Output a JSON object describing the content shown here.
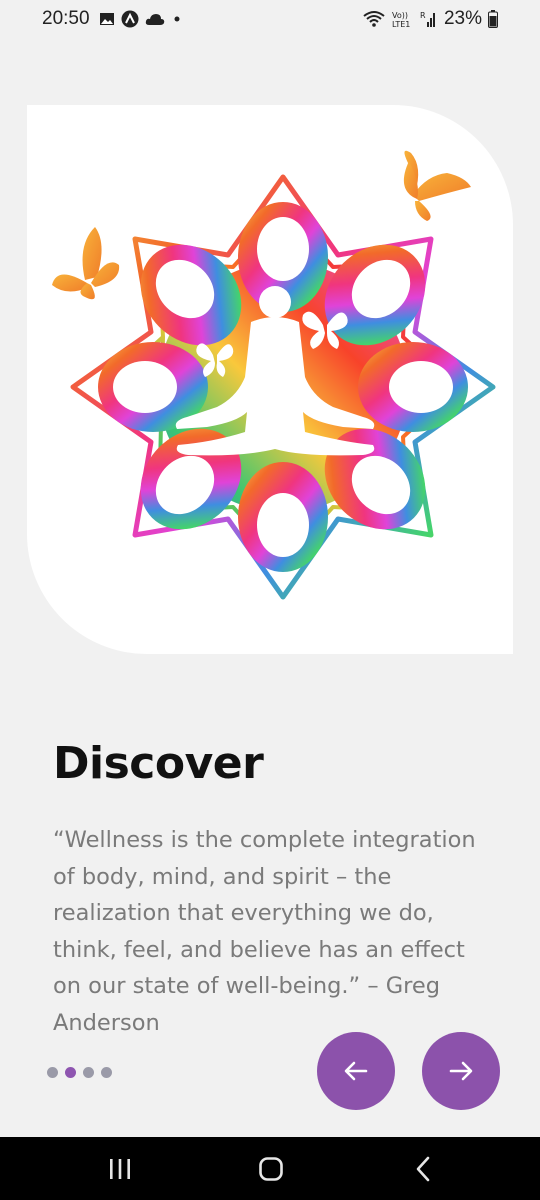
{
  "status_bar": {
    "time": "20:50",
    "left_icons": [
      "image-icon",
      "app-icon",
      "cloud-icon",
      "dot-icon"
    ],
    "right_icons": [
      "wifi-icon",
      "volte-icon",
      "signal-icon",
      "battery-icon"
    ],
    "network_label": "Vo) R\nLTE1",
    "battery_percent": "23%"
  },
  "onboarding": {
    "title": "Discover",
    "quote": "“Wellness is the complete integration of body, mind, and spirit – the realization that everything we do, think, feel, and believe has an effect on our state of well-being.” – Greg Anderson",
    "page_count": 4,
    "active_page": 1,
    "prev_icon": "arrow-left-icon",
    "next_icon": "arrow-right-icon"
  },
  "colors": {
    "accent": "#8c52ab",
    "background": "#f1f1f1",
    "card": "#ffffff",
    "title": "#111111",
    "body_text": "#7a7a7a"
  },
  "system_nav": {
    "icons": [
      "recent-apps-icon",
      "home-icon",
      "back-icon"
    ]
  }
}
